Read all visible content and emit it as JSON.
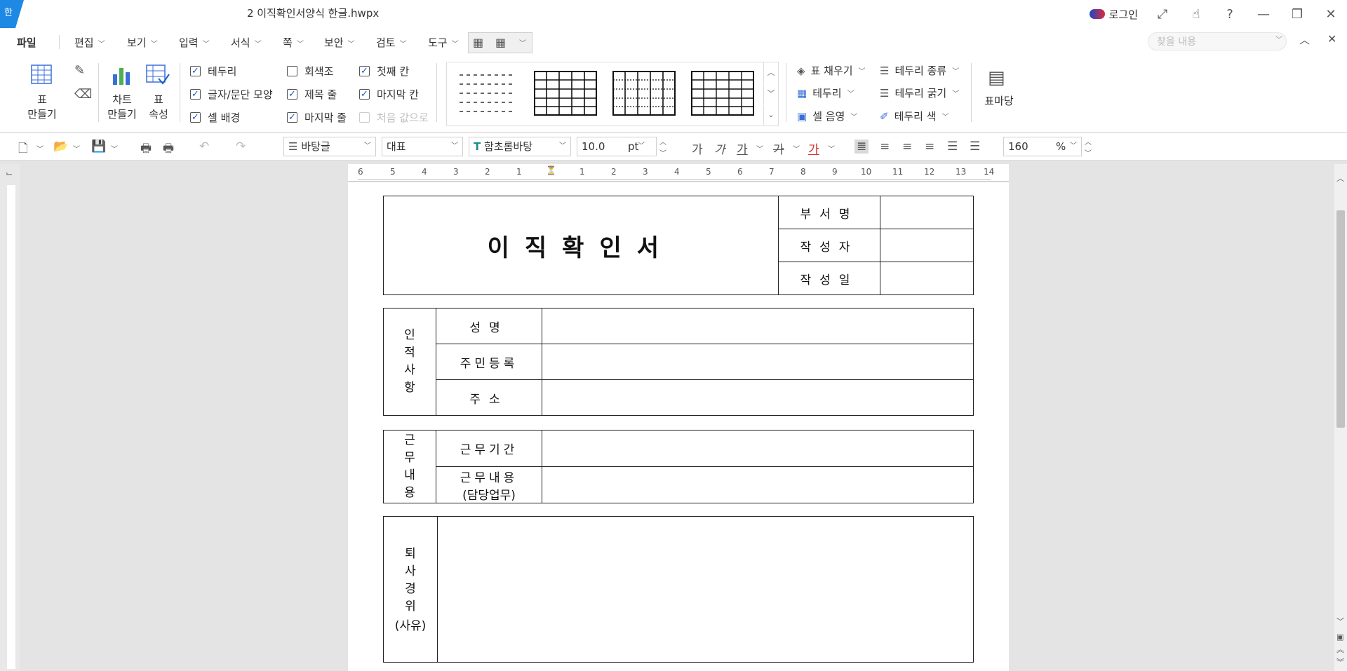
{
  "app": {
    "icon_text": "한",
    "doc_title": "2 이직확인서양식 한글.hwpx",
    "login_label": "로그인",
    "accent": "#1e88e5"
  },
  "menu": {
    "file": "파일",
    "items": [
      "편집",
      "보기",
      "입력",
      "서식",
      "쪽",
      "보안",
      "검토",
      "도구"
    ],
    "find_placeholder": "찾을 내용"
  },
  "ribbon": {
    "table_make": "표\n만들기",
    "chart_make": "차트\n만들기",
    "table_props": "표\n속성",
    "checks": [
      {
        "label": "테두리",
        "checked": true,
        "disabled": false
      },
      {
        "label": "글자/문단 모양",
        "checked": true,
        "disabled": false
      },
      {
        "label": "셀 배경",
        "checked": true,
        "disabled": false
      },
      {
        "label": "회색조",
        "checked": false,
        "disabled": false
      },
      {
        "label": "제목 줄",
        "checked": true,
        "disabled": false
      },
      {
        "label": "마지막 줄",
        "checked": true,
        "disabled": false
      },
      {
        "label": "첫째 칸",
        "checked": true,
        "disabled": false
      },
      {
        "label": "마지막 칸",
        "checked": true,
        "disabled": false
      },
      {
        "label": "처음 값으로",
        "checked": false,
        "disabled": true
      }
    ],
    "fill": "표 채우기",
    "border": "테두리",
    "cell_shade": "셀 음영",
    "border_type": "테두리 종류",
    "border_width": "테두리 굵기",
    "border_color": "테두리 색",
    "table_yard": "표마당"
  },
  "format": {
    "style": "바탕글",
    "lang": "대표",
    "font": "함초롬바탕",
    "size": "10.0",
    "unit": "pt",
    "zoom": "160",
    "zoom_unit": "%"
  },
  "ruler": {
    "h_ticks": [
      "6",
      "5",
      "4",
      "3",
      "2",
      "1",
      "1",
      "2",
      "3",
      "4",
      "5",
      "6",
      "7",
      "8",
      "9",
      "10",
      "11",
      "12",
      "13",
      "14"
    ]
  },
  "document": {
    "title": "이직확인서",
    "header_rows": [
      "부서명",
      "작성자",
      "작성일"
    ],
    "personal": {
      "group": "인적사항",
      "rows": [
        "성명",
        "주민등록",
        "주소"
      ]
    },
    "work": {
      "group": "근무내용",
      "rows": [
        "근무기간",
        "근무내용"
      ],
      "row2_sub": "(담당업무)"
    },
    "reason": {
      "group": "퇴사경위",
      "sub": "(사유)"
    }
  }
}
